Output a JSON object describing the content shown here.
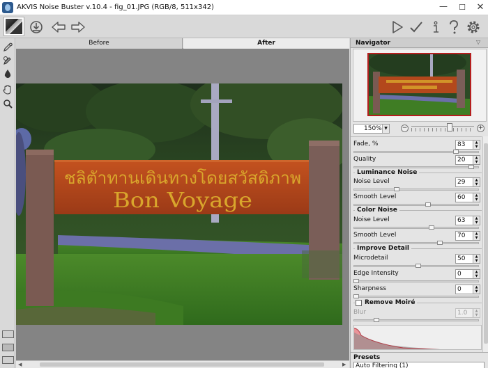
{
  "window": {
    "title": "AKVIS Noise Buster v.10.4 - fig_01.JPG (RGB/8, 511x342)",
    "minimize": "—",
    "maximize": "☐",
    "close": "✕"
  },
  "toolbar": {
    "icons": [
      "image-thumbnail",
      "load-settings-icon",
      "back-arrow-icon",
      "forward-arrow-icon",
      "run-icon",
      "apply-icon",
      "info-icon",
      "help-icon",
      "settings-gear-icon"
    ]
  },
  "tabs": {
    "before": "Before",
    "after": "After",
    "active": "after"
  },
  "photo": {
    "sign_top_text": "ชลิตัาทานเดินทางโดยสวัสดิภาพ",
    "sign_bottom_text": "Bon Voyage",
    "colors": {
      "sign": "#b3481c",
      "lettering": "#d9a62c",
      "grass": "#3d7a22",
      "road": "#6a6fa6",
      "post": "#7d5b4f"
    }
  },
  "navigator": {
    "title": "Navigator",
    "zoom": "150%",
    "zoom_minus": "−",
    "zoom_plus": "+",
    "zoom_level": 0.62
  },
  "settings": {
    "fade": {
      "label": "Fade, %",
      "value": "83",
      "level": 0.83
    },
    "quality": {
      "label": "Quality",
      "value": "20",
      "level": 0.96
    },
    "luminance": {
      "title": "Luminance Noise",
      "noise_level": {
        "label": "Noise Level",
        "value": "29",
        "level": 0.34
      },
      "smooth_level": {
        "label": "Smooth Level",
        "value": "60",
        "level": 0.6
      }
    },
    "color": {
      "title": "Color Noise",
      "noise_level": {
        "label": "Noise Level",
        "value": "63",
        "level": 0.63
      },
      "smooth_level": {
        "label": "Smooth Level",
        "value": "70",
        "level": 0.7
      }
    },
    "detail": {
      "title": "Improve Detail",
      "microdetail": {
        "label": "Microdetail",
        "value": "50",
        "level": 0.52
      },
      "edge_intensity": {
        "label": "Edge Intensity",
        "value": "0",
        "level": 0.0
      },
      "sharpness": {
        "label": "Sharpness",
        "value": "0",
        "level": 0.0
      }
    },
    "moire": {
      "title": "Remove Moiré",
      "checked": false,
      "blur": {
        "label": "Blur",
        "value": "1.0",
        "level": 0.17
      }
    }
  },
  "presets": {
    "title": "Presets",
    "selected": "Auto Filtering (1)"
  }
}
